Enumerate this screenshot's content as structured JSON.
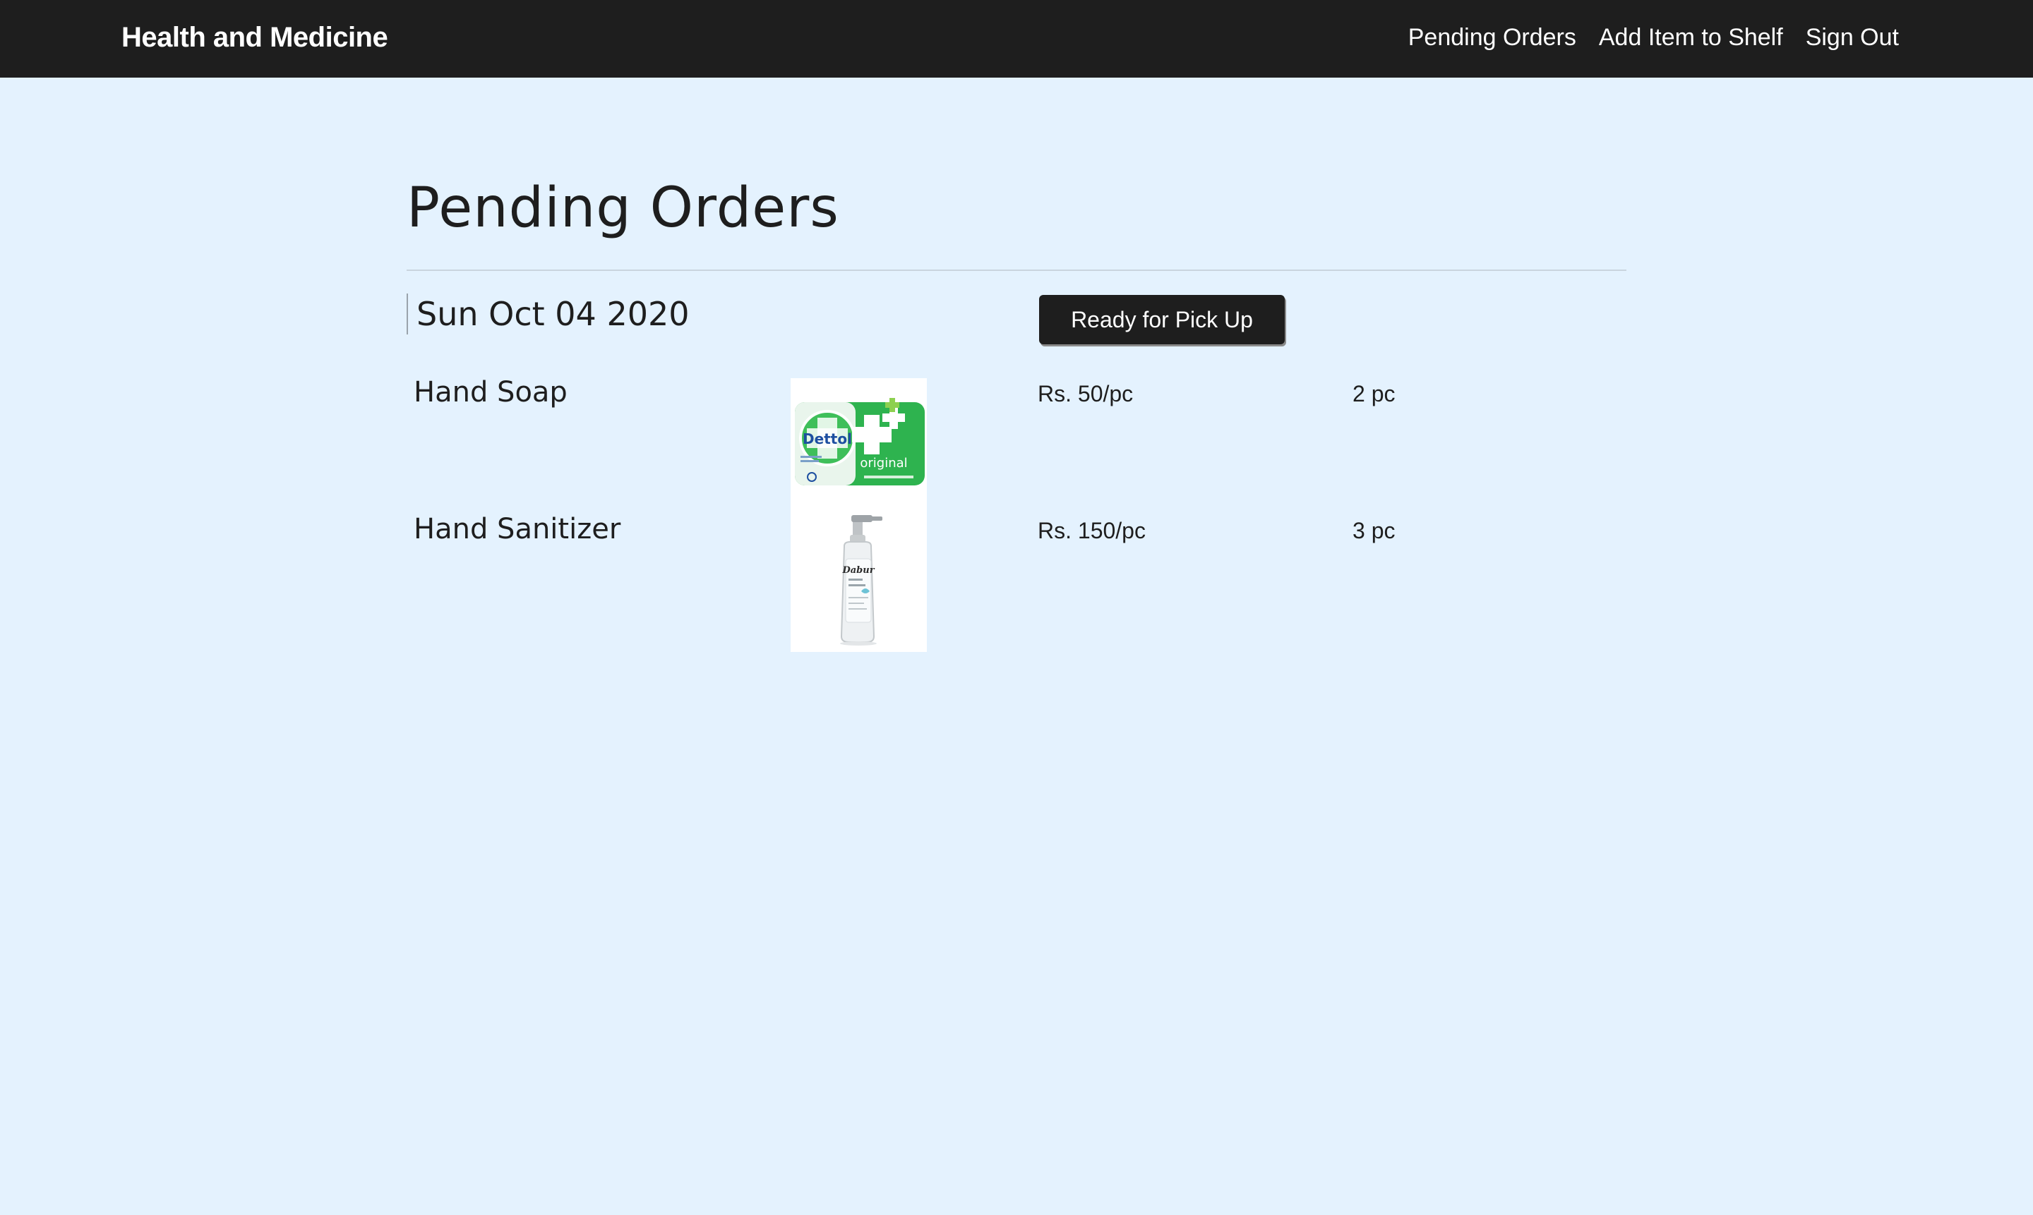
{
  "navbar": {
    "brand": "Health and Medicine",
    "links": [
      "Pending Orders",
      "Add Item to Shelf",
      "Sign Out"
    ]
  },
  "page": {
    "title": "Pending Orders"
  },
  "order": {
    "date": "Sun Oct 04 2020",
    "action_label": "Ready for Pick Up",
    "items": [
      {
        "name": "Hand Soap",
        "image_icon": "dettol-soap-image",
        "image_text": [
          "Dettol",
          "original"
        ],
        "price": "Rs. 50/pc",
        "quantity": "2 pc"
      },
      {
        "name": "Hand Sanitizer",
        "image_icon": "sanitizer-bottle-image",
        "image_text": [
          "Dabur"
        ],
        "price": "Rs. 150/pc",
        "quantity": "3 pc"
      }
    ]
  },
  "colors": {
    "navbar_bg": "#1e1e1e",
    "page_bg": "#e4f2fe",
    "text": "#1e1e1e",
    "button_bg": "#1e1e1e",
    "soap_green": "#2eb34f"
  }
}
